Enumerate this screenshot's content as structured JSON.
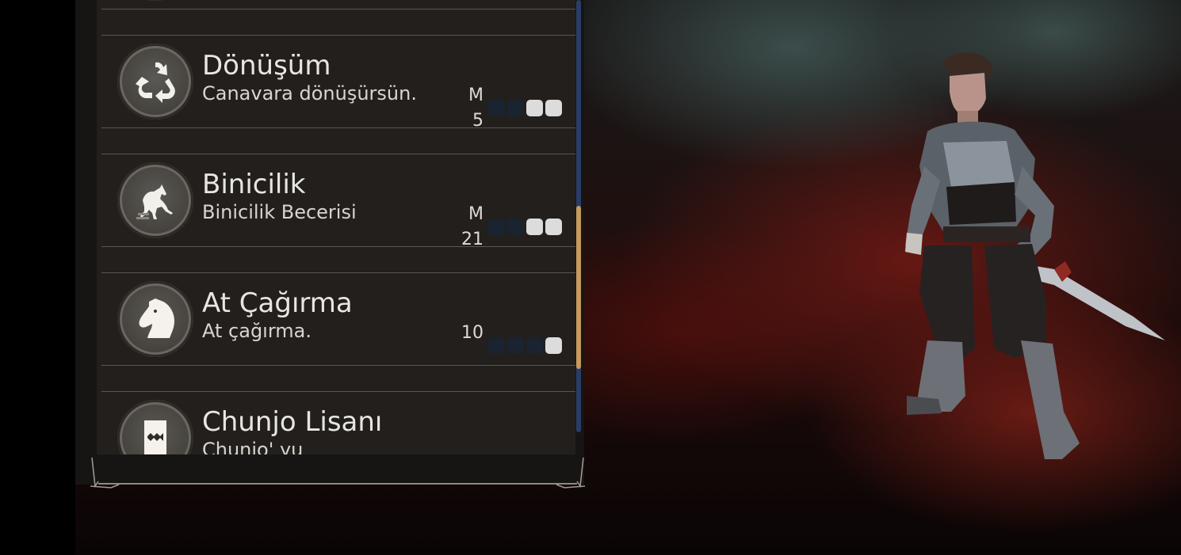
{
  "skills": [
    {
      "name": "Dönüşüm",
      "description": "Canavara dönüşürsün.",
      "grade_label": "M",
      "level": "5",
      "pips_on": 2,
      "icon": "transform-cycle-icon"
    },
    {
      "name": "Binicilik",
      "description": "Binicilik Becerisi",
      "grade_label": "M",
      "level": "21",
      "pips_on": 2,
      "icon": "horse-riding-icon"
    },
    {
      "name": "At Çağırma",
      "description": "At çağırma.",
      "grade_label": "",
      "level": "10",
      "pips_on": 1,
      "icon": "horse-head-icon"
    },
    {
      "name": "Chunjo Lisanı",
      "description": "Chunjo' yu",
      "grade_label": "",
      "level": "",
      "pips_on": 0,
      "icon": "language-scroll-icon"
    }
  ],
  "scrollbar": {
    "position": 0.62
  },
  "colors": {
    "panel_bg": "#221f1d",
    "pip_on": "#dcdcdc",
    "pip_off": "#1a2330",
    "scroll_thumb": "#c69a5c",
    "scroll_track": "#2a3d66"
  }
}
